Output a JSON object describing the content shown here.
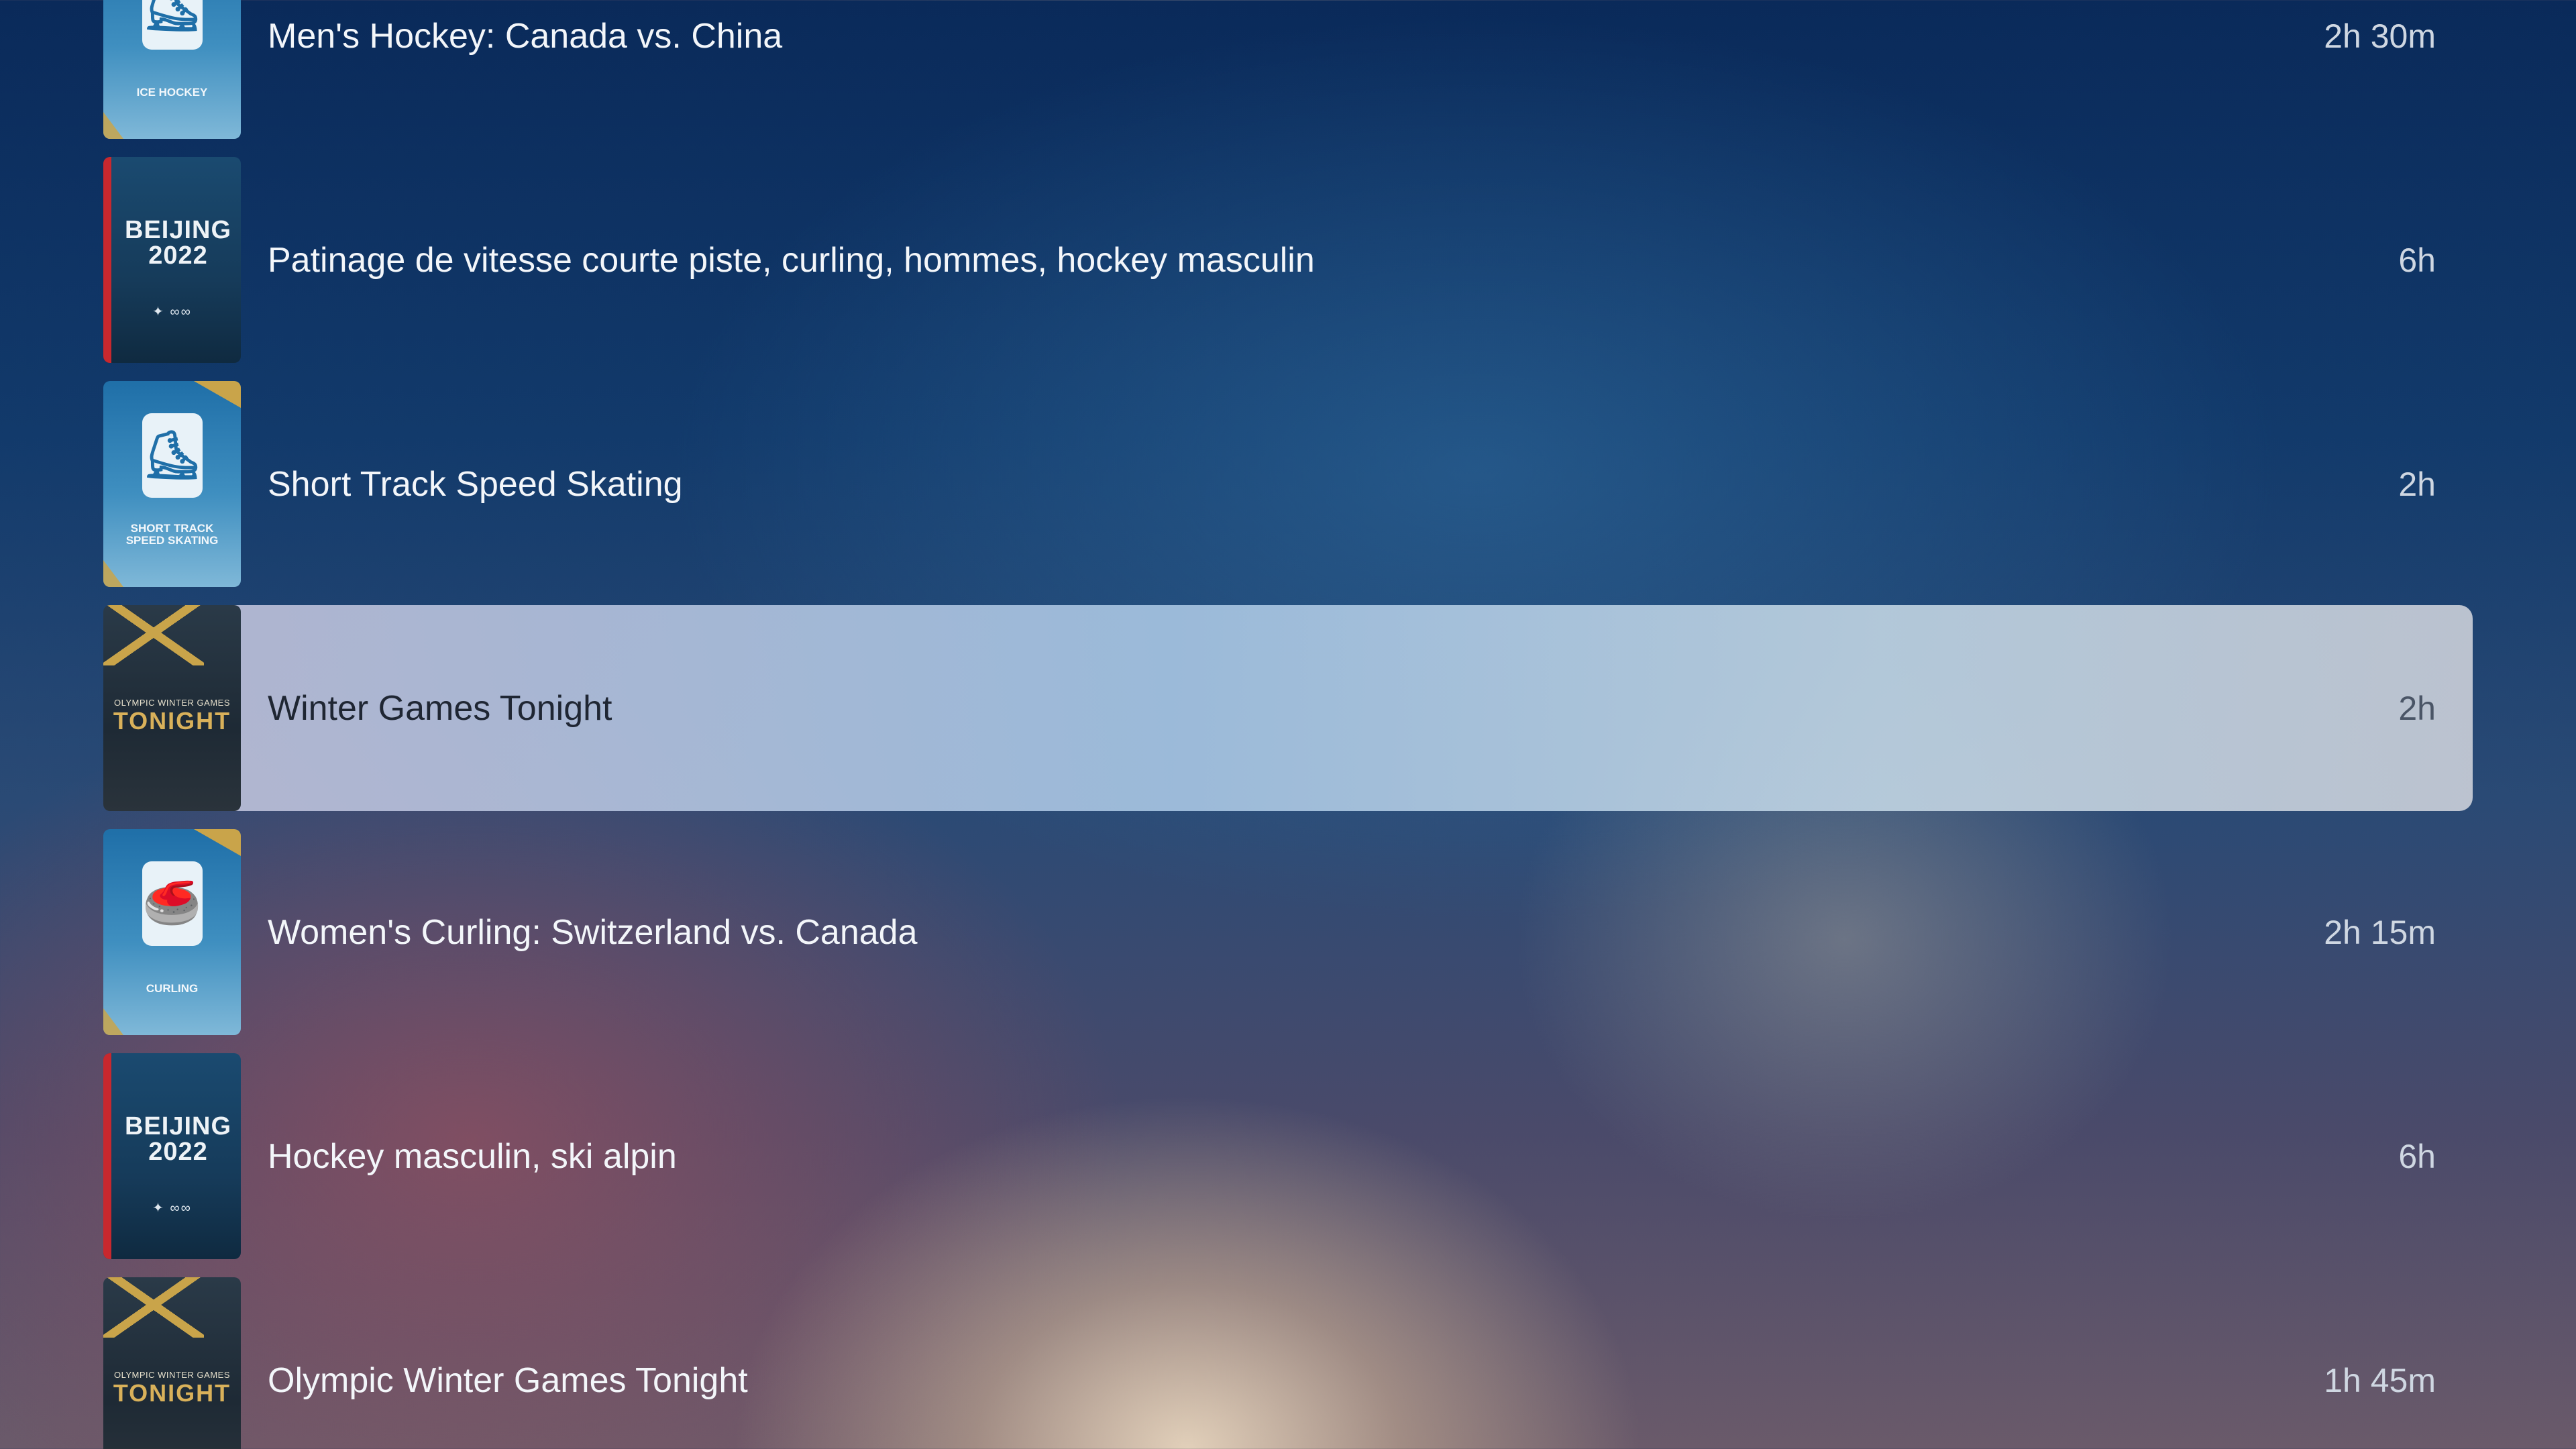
{
  "programs": [
    {
      "title": "Men's Hockey: Canada vs. China",
      "duration": "2h 30m",
      "thumb_label": "ICE HOCKEY",
      "thumb_type": "sport",
      "icon": "ice-hockey-icon"
    },
    {
      "title": "Patinage de vitesse courte piste, curling, hommes, hockey masculin",
      "duration": "6h",
      "thumb_label": "BEIJING\n2022",
      "thumb_type": "beijing"
    },
    {
      "title": "Short Track Speed Skating",
      "duration": "2h",
      "thumb_label": "SHORT TRACK\nSPEED SKATING",
      "thumb_type": "sport",
      "icon": "short-track-icon"
    },
    {
      "title": "Winter Games Tonight",
      "duration": "2h",
      "thumb_label_small": "OLYMPIC WINTER GAMES",
      "thumb_label": "TONIGHT",
      "thumb_type": "tonight",
      "focused": true
    },
    {
      "title": "Women's Curling: Switzerland vs. Canada",
      "duration": "2h 15m",
      "thumb_label": "CURLING",
      "thumb_type": "sport",
      "icon": "curling-icon"
    },
    {
      "title": "Hockey masculin, ski alpin",
      "duration": "6h",
      "thumb_label": "BEIJING\n2022",
      "thumb_type": "beijing"
    },
    {
      "title": "Olympic Winter Games Tonight",
      "duration": "1h 45m",
      "thumb_label_small": "OLYMPIC WINTER GAMES",
      "thumb_label": "TONIGHT",
      "thumb_type": "tonight"
    }
  ],
  "colors": {
    "focus_highlight": "#b4c8dc",
    "gold_accent": "#c9a44a",
    "beijing_red": "#c8282e"
  }
}
